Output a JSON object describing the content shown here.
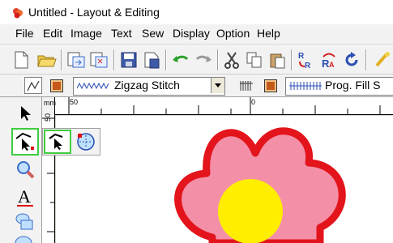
{
  "window": {
    "title": "Untitled - Layout & Editing"
  },
  "menu": {
    "items": [
      "File",
      "Edit",
      "Image",
      "Text",
      "Sew",
      "Display",
      "Option",
      "Help"
    ]
  },
  "toolbar": {
    "icons": [
      "new-file-icon",
      "open-folder-icon",
      "import-pattern-icon",
      "import-design-icon",
      "save-icon",
      "save-as-icon",
      "undo-icon",
      "redo-icon",
      "cut-icon",
      "copy-icon",
      "paste-icon",
      "rotate-icon",
      "reset-rotate-icon",
      "refresh-icon",
      "more-icon"
    ]
  },
  "sew_toolbar": {
    "line_sew_type": "Zigzag Stitch",
    "region_sew_type": "Prog. Fill S"
  },
  "ruler": {
    "labels": [
      "mm",
      "50",
      "0",
      "50"
    ]
  },
  "colors": {
    "petal": "#f48fa8",
    "outline": "#e3141b",
    "center": "#ffee00",
    "tool_highlight": "#3fcc3f"
  }
}
